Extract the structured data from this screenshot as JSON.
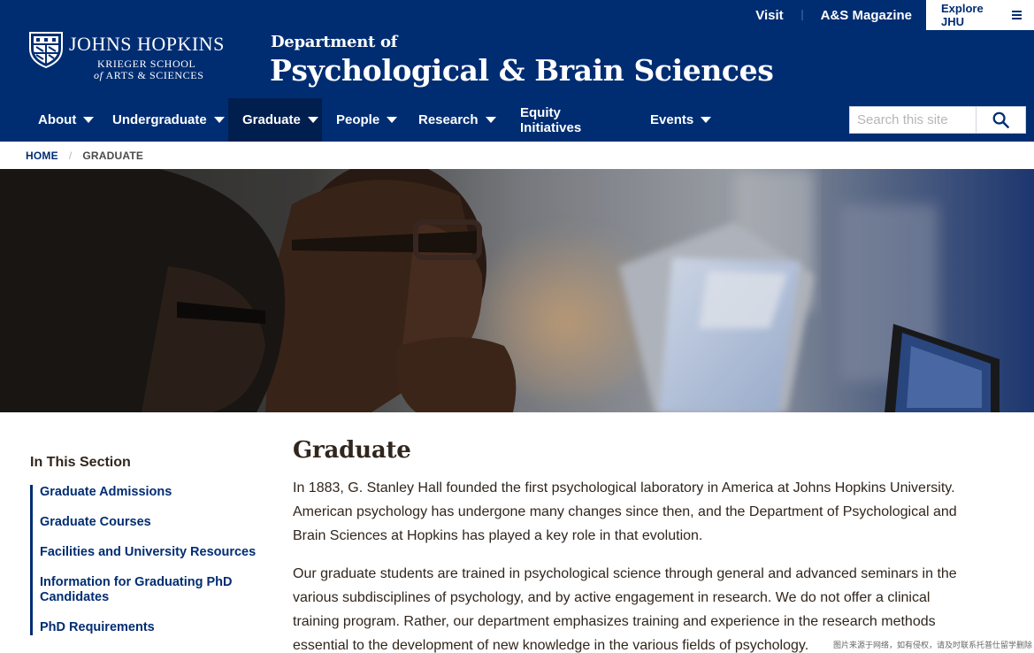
{
  "utility": {
    "visit": "Visit",
    "magazine": "A&S Magazine",
    "explore": "Explore JHU"
  },
  "logo": {
    "university": "JOHNS HOPKINS",
    "school_line1": "KRIEGER SCHOOL",
    "school_of": "of",
    "school_line2": "ARTS & SCIENCES"
  },
  "department": {
    "prefix": "Department of",
    "name": "Psychological & Brain Sciences"
  },
  "nav": {
    "items": [
      {
        "label": "About",
        "dropdown": true
      },
      {
        "label": "Undergraduate",
        "dropdown": true
      },
      {
        "label": "Graduate",
        "dropdown": true,
        "active": true
      },
      {
        "label": "People",
        "dropdown": true
      },
      {
        "label": "Research",
        "dropdown": true
      },
      {
        "label": "Equity Initiatives",
        "dropdown": false
      },
      {
        "label": "Events",
        "dropdown": true
      }
    ]
  },
  "search": {
    "placeholder": "Search this site",
    "icon": "search-icon"
  },
  "breadcrumb": {
    "home": "HOME",
    "separator": "/",
    "current": "GRADUATE"
  },
  "hero": {
    "alt_icon": "students-with-laptops-photo"
  },
  "sidebar": {
    "title": "In This Section",
    "items": [
      {
        "label": "Graduate Admissions"
      },
      {
        "label": "Graduate Courses"
      },
      {
        "label": "Facilities and University Resources"
      },
      {
        "label": "Information for Graduating PhD Candidates"
      },
      {
        "label": "PhD Requirements"
      }
    ]
  },
  "main": {
    "title": "Graduate",
    "paragraphs": [
      "In 1883, G. Stanley Hall founded the first psychological laboratory in America at Johns Hopkins University. American psychology has undergone many changes since then, and the Department of Psychological and Brain Sciences at Hopkins has played a key role in that evolution.",
      "Our graduate students are trained in psychological science through general and advanced seminars in the various subdisciplines of psychology, and by active engagement in research. We do not offer a clinical training program. Rather, our department emphasizes training and experience in the research methods essential to the development of new knowledge in the various fields of psychology."
    ]
  },
  "watermark": "图片来源于网络，如有侵权，请及时联系托普仕留学删除",
  "colors": {
    "brand_blue": "#002d72",
    "nav_active": "#001e4e",
    "text": "#31261d"
  }
}
